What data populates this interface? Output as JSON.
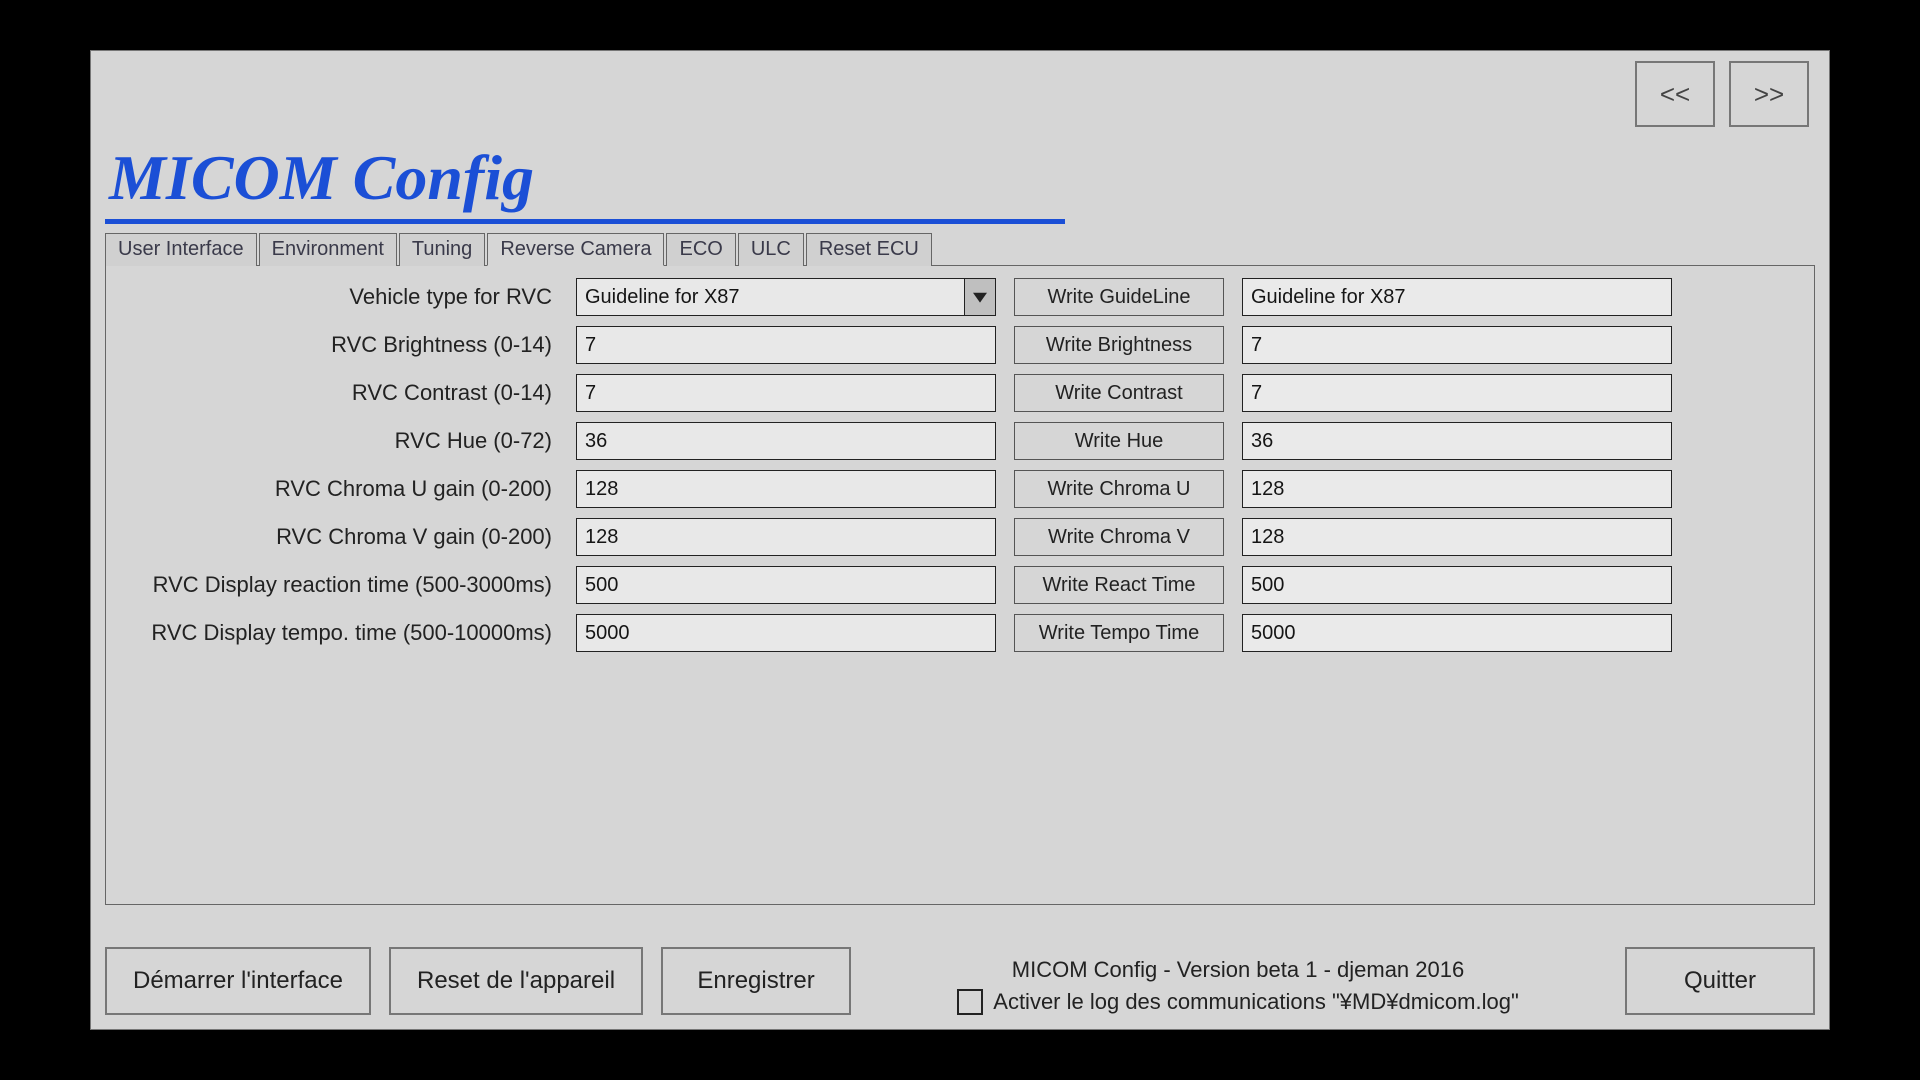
{
  "nav": {
    "prev": "<<",
    "next": ">>"
  },
  "title": "MICOM Config",
  "tabs": [
    {
      "label": "User Interface",
      "selected": false
    },
    {
      "label": "Environment",
      "selected": false
    },
    {
      "label": "Tuning",
      "selected": false
    },
    {
      "label": "Reverse Camera",
      "selected": true
    },
    {
      "label": "ECO",
      "selected": false
    },
    {
      "label": "ULC",
      "selected": false
    },
    {
      "label": "Reset ECU",
      "selected": false
    }
  ],
  "rvc": {
    "rows": [
      {
        "label": "Vehicle type for RVC",
        "value": "Guideline for X87",
        "is_select": true,
        "write_btn": "Write GuideLine",
        "readback": "Guideline for X87"
      },
      {
        "label": "RVC Brightness (0-14)",
        "value": "7",
        "is_select": false,
        "write_btn": "Write Brightness",
        "readback": "7"
      },
      {
        "label": "RVC Contrast (0-14)",
        "value": "7",
        "is_select": false,
        "write_btn": "Write Contrast",
        "readback": "7"
      },
      {
        "label": "RVC Hue (0-72)",
        "value": "36",
        "is_select": false,
        "write_btn": "Write Hue",
        "readback": "36"
      },
      {
        "label": "RVC Chroma U gain (0-200)",
        "value": "128",
        "is_select": false,
        "write_btn": "Write Chroma U",
        "readback": "128"
      },
      {
        "label": "RVC Chroma V gain (0-200)",
        "value": "128",
        "is_select": false,
        "write_btn": "Write Chroma V",
        "readback": "128"
      },
      {
        "label": "RVC Display reaction time (500-3000ms)",
        "value": "500",
        "is_select": false,
        "write_btn": "Write React Time",
        "readback": "500"
      },
      {
        "label": "RVC Display tempo. time (500-10000ms)",
        "value": "5000",
        "is_select": false,
        "write_btn": "Write Tempo Time",
        "readback": "5000"
      }
    ]
  },
  "footer": {
    "start": "Démarrer l'interface",
    "reset": "Reset de l'appareil",
    "save": "Enregistrer",
    "quit": "Quitter",
    "version": "MICOM Config - Version beta 1 - djeman 2016",
    "log_checkbox_label": "Activer le log des communications \"¥MD¥dmicom.log\"",
    "log_enabled": false
  }
}
